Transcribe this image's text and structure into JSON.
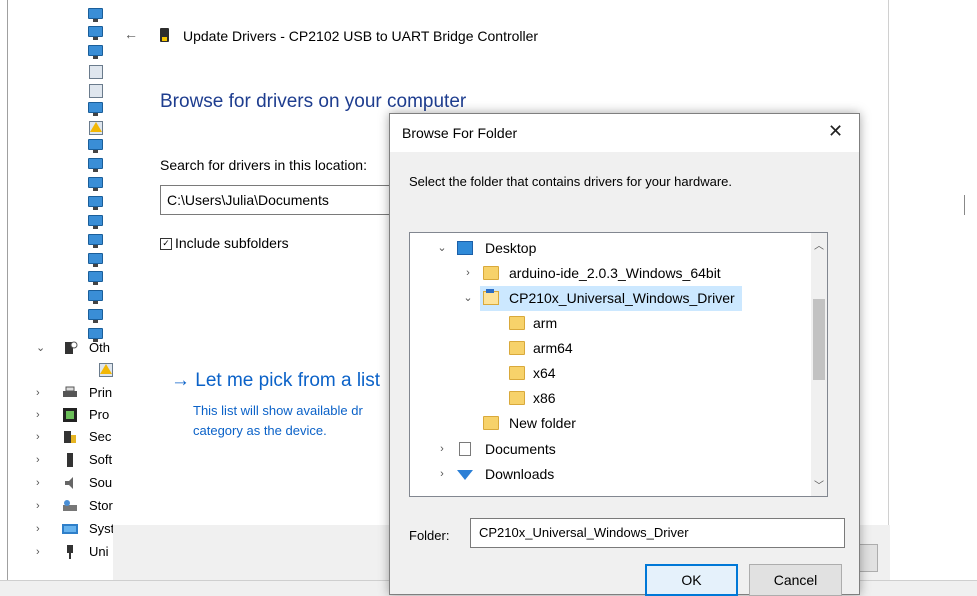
{
  "device_manager": {
    "categories": [
      {
        "label": "Oth",
        "expanded": true,
        "icon": "unknown-device-icon"
      },
      {
        "label": "Prin",
        "icon": "printer-icon"
      },
      {
        "label": "Pro",
        "icon": "processor-icon"
      },
      {
        "label": "Sec",
        "icon": "security-device-icon"
      },
      {
        "label": "Soft",
        "icon": "software-device-icon"
      },
      {
        "label": "Sou",
        "icon": "sound-icon"
      },
      {
        "label": "Stor",
        "icon": "storage-controller-icon"
      },
      {
        "label": "Syst",
        "icon": "system-device-icon"
      },
      {
        "label": "Uni",
        "icon": "usb-controller-icon"
      }
    ]
  },
  "wizard": {
    "title": "Update Drivers - CP2102 USB to UART Bridge Controller",
    "heading": "Browse for drivers on your computer",
    "search_label": "Search for drivers in this location:",
    "path_value": "C:\\Users\\Julia\\Documents",
    "include_subfolders": "Include subfolders",
    "pick_link": "Let me pick from a list",
    "pick_desc": "This list will show available dr category as the device."
  },
  "dialog": {
    "title": "Browse For Folder",
    "instruction": "Select the folder that contains drivers for your hardware.",
    "tree": [
      {
        "label": "Desktop",
        "icon": "desktop-icon",
        "chevron": "⌄"
      },
      {
        "label": "arduino-ide_2.0.3_Windows_64bit",
        "icon": "folder-icon",
        "chevron": "›"
      },
      {
        "label": "CP210x_Universal_Windows_Driver",
        "icon": "folder-icon",
        "chevron": "⌄",
        "selected": true
      },
      {
        "label": "arm",
        "icon": "folder-icon"
      },
      {
        "label": "arm64",
        "icon": "folder-icon"
      },
      {
        "label": "x64",
        "icon": "folder-icon"
      },
      {
        "label": "x86",
        "icon": "folder-icon"
      },
      {
        "label": "New folder",
        "icon": "folder-icon"
      },
      {
        "label": "Documents",
        "icon": "documents-icon",
        "chevron": "›"
      },
      {
        "label": "Downloads",
        "icon": "downloads-icon",
        "chevron": "›"
      }
    ],
    "folder_label": "Folder:",
    "folder_value": "CP210x_Universal_Windows_Driver",
    "ok": "OK",
    "cancel": "Cancel"
  },
  "colors": {
    "heading": "#1e3d8f",
    "link": "#0b62c8",
    "selection": "#cce8ff",
    "ok_border": "#0078d7"
  }
}
